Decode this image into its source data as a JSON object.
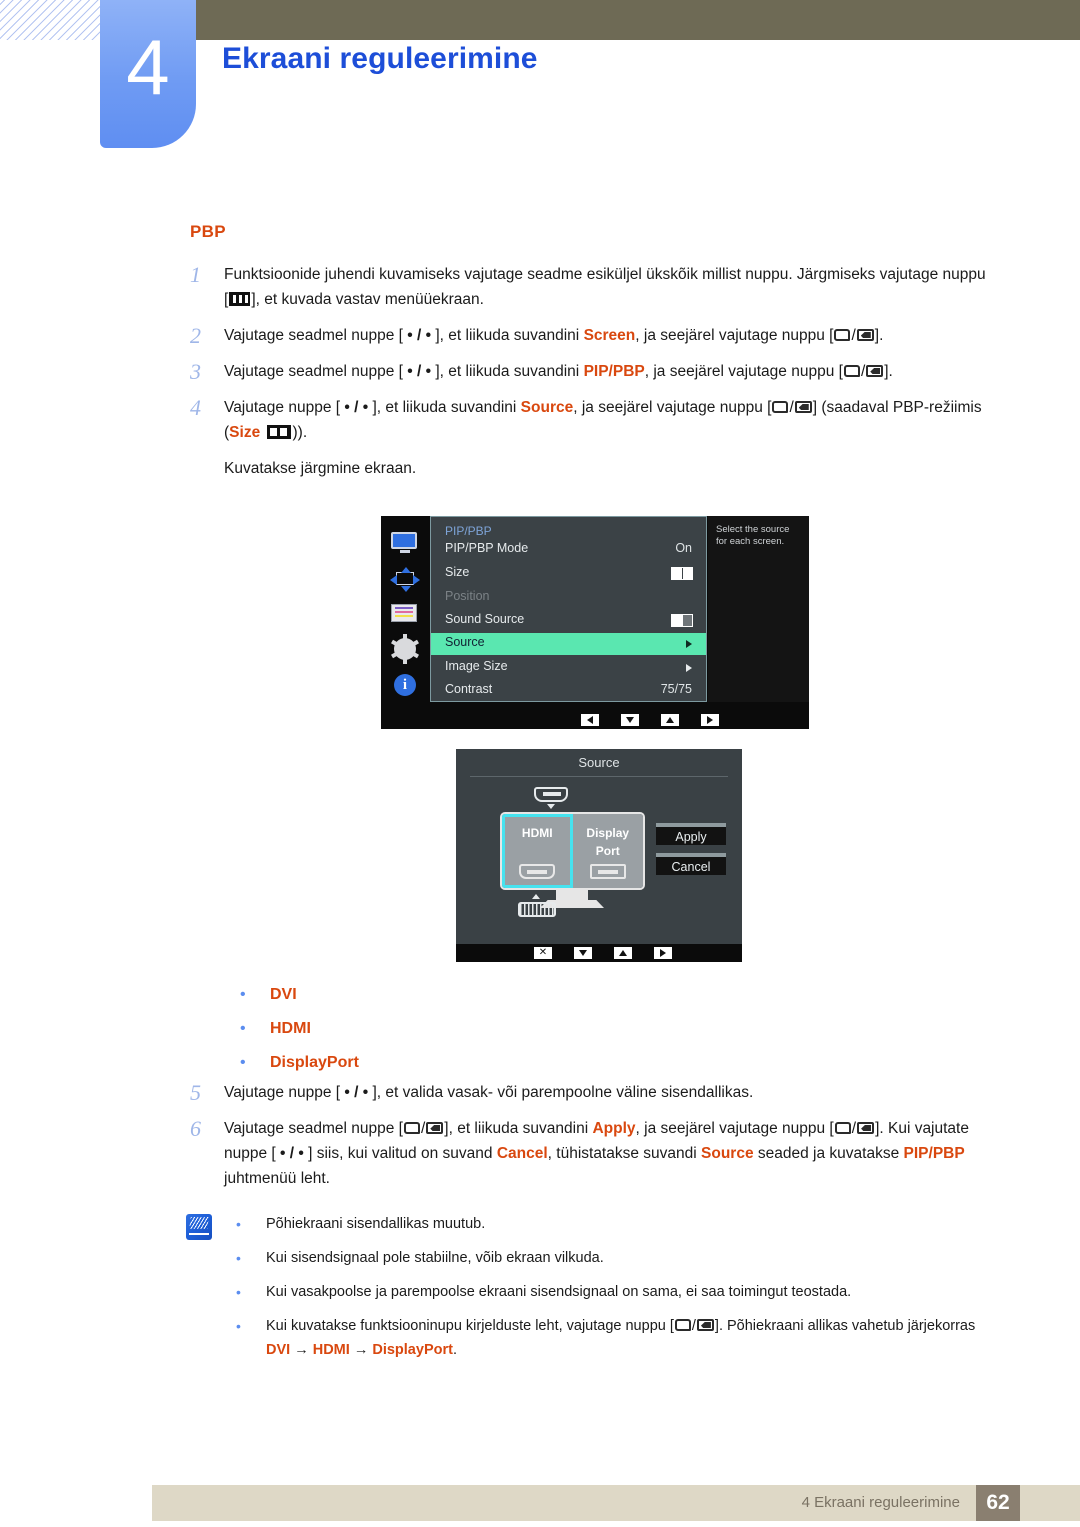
{
  "header": {
    "chapter_number": "4",
    "chapter_title": "Ekraani reguleerimine"
  },
  "section": {
    "heading": "PBP"
  },
  "steps": [
    {
      "num": "1",
      "parts": [
        {
          "t": "Funktsioonide juhendi kuvamiseks vajutage seadme esiküljel ükskõik millist nuppu. Järgmiseks vajutage nuppu [",
          "k": "plain"
        },
        {
          "t": "menu-icon",
          "k": "glyph-menu"
        },
        {
          "t": "], et kuvada vastav menüüekraan.",
          "k": "plain"
        }
      ]
    },
    {
      "num": "2",
      "parts": [
        {
          "t": "Vajutage seadmel nuppe [ ",
          "k": "plain"
        },
        {
          "t": "• / •",
          "k": "dot"
        },
        {
          "t": " ], et liikuda suvandini ",
          "k": "plain"
        },
        {
          "t": "Screen",
          "k": "orange"
        },
        {
          "t": ", ja seejärel vajutage nuppu [",
          "k": "plain"
        },
        {
          "t": "enter-icon",
          "k": "glyph-enter"
        },
        {
          "t": "].",
          "k": "plain"
        }
      ]
    },
    {
      "num": "3",
      "parts": [
        {
          "t": "Vajutage seadmel nuppe [ ",
          "k": "plain"
        },
        {
          "t": "• / •",
          "k": "dot"
        },
        {
          "t": " ], et liikuda suvandini ",
          "k": "plain"
        },
        {
          "t": "PIP/PBP",
          "k": "orange"
        },
        {
          "t": ", ja seejärel vajutage nuppu [",
          "k": "plain"
        },
        {
          "t": "enter-icon",
          "k": "glyph-enter"
        },
        {
          "t": "].",
          "k": "plain"
        }
      ]
    },
    {
      "num": "4",
      "parts": [
        {
          "t": "Vajutage nuppe [ ",
          "k": "plain"
        },
        {
          "t": "• / •",
          "k": "dot"
        },
        {
          "t": " ], et liikuda suvandini ",
          "k": "plain"
        },
        {
          "t": "Source",
          "k": "orange"
        },
        {
          "t": ", ja seejärel vajutage nuppu [",
          "k": "plain"
        },
        {
          "t": "enter-icon",
          "k": "glyph-enter"
        },
        {
          "t": "] (saadaval PBP-režiimis (",
          "k": "plain"
        },
        {
          "t": "Size",
          "k": "orange"
        },
        {
          "t": " ",
          "k": "plain"
        },
        {
          "t": "size-icon",
          "k": "glyph-size"
        },
        {
          "t": ")).",
          "k": "plain"
        }
      ]
    }
  ],
  "after_step4_line": "Kuvatakse järgmine ekraan.",
  "osd_pipbp": {
    "title": "PIP/PBP",
    "tooltip": "Select the source for each screen.",
    "rows": [
      {
        "label": "PIP/PBP Mode",
        "value": "On",
        "kind": "text"
      },
      {
        "label": "Size",
        "value": "",
        "kind": "size"
      },
      {
        "label": "Position",
        "value": "",
        "kind": "dim"
      },
      {
        "label": "Sound Source",
        "value": "",
        "kind": "sound"
      },
      {
        "label": "Source",
        "value": "",
        "kind": "selected"
      },
      {
        "label": "Image Size",
        "value": "",
        "kind": "arrow"
      },
      {
        "label": "Contrast",
        "value": "75/75",
        "kind": "text"
      }
    ],
    "sidebar_icons": [
      "monitor-icon",
      "pip-position-icon",
      "color-bars-icon",
      "gear-icon",
      "info-icon"
    ],
    "control_keys": [
      "left-arrow-key",
      "down-arrow-key",
      "up-arrow-key",
      "right-arrow-key"
    ]
  },
  "osd_source": {
    "title": "Source",
    "left_screen": {
      "line1": "HDMI",
      "line2": ""
    },
    "right_screen": {
      "line1": "Display",
      "line2": "Port"
    },
    "apply_label": "Apply",
    "cancel_label": "Cancel",
    "control_keys": [
      "close-key",
      "down-arrow-key",
      "up-arrow-key",
      "right-arrow-key"
    ]
  },
  "source_list": [
    "DVI",
    "HDMI",
    "DisplayPort"
  ],
  "steps2": [
    {
      "num": "5",
      "parts": [
        {
          "t": "Vajutage nuppe [ ",
          "k": "plain"
        },
        {
          "t": "• / •",
          "k": "dot"
        },
        {
          "t": " ], et valida vasak- või parempoolne väline sisendallikas.",
          "k": "plain"
        }
      ]
    },
    {
      "num": "6",
      "parts": [
        {
          "t": "Vajutage seadmel nuppe [",
          "k": "plain"
        },
        {
          "t": "enter-icon",
          "k": "glyph-enter"
        },
        {
          "t": "], et liikuda suvandini ",
          "k": "plain"
        },
        {
          "t": "Apply",
          "k": "orange"
        },
        {
          "t": ", ja seejärel vajutage nuppu [",
          "k": "plain"
        },
        {
          "t": "enter-icon",
          "k": "glyph-enter"
        },
        {
          "t": "]. Kui vajutate nuppe [ ",
          "k": "plain"
        },
        {
          "t": "• / •",
          "k": "dot"
        },
        {
          "t": " ] siis, kui valitud on suvand ",
          "k": "plain"
        },
        {
          "t": "Cancel",
          "k": "orange"
        },
        {
          "t": ", tühistatakse suvandi ",
          "k": "plain"
        },
        {
          "t": "Source",
          "k": "orange"
        },
        {
          "t": " seaded ja kuvatakse ",
          "k": "plain"
        },
        {
          "t": "PIP/PBP",
          "k": "orange"
        },
        {
          "t": " juhtmenüü leht.",
          "k": "plain"
        }
      ]
    }
  ],
  "note": {
    "icon": "note-pencil-icon",
    "items": [
      [
        {
          "t": "Põhiekraani sisendallikas muutub.",
          "k": "plain"
        }
      ],
      [
        {
          "t": "Kui sisendsignaal pole stabiilne, võib ekraan vilkuda.",
          "k": "plain"
        }
      ],
      [
        {
          "t": "Kui vasakpoolse ja parempoolse ekraani sisendsignaal on sama, ei saa toimingut teostada.",
          "k": "plain"
        }
      ],
      [
        {
          "t": "Kui kuvatakse funktsiooninupu kirjelduste leht, vajutage nuppu [",
          "k": "plain"
        },
        {
          "t": "enter-icon",
          "k": "glyph-enter"
        },
        {
          "t": "]. Põhiekraani allikas vahetub järjekorras ",
          "k": "plain"
        },
        {
          "t": "DVI",
          "k": "orange"
        },
        {
          "t": "  →  ",
          "k": "plain"
        },
        {
          "t": "HDMI",
          "k": "orange"
        },
        {
          "t": "  →  ",
          "k": "plain"
        },
        {
          "t": "DisplayPort",
          "k": "orange"
        },
        {
          "t": ".",
          "k": "plain"
        }
      ]
    ]
  },
  "footer": {
    "text": "4 Ekraani reguleerimine",
    "page": "62"
  },
  "colors": {
    "accent_orange": "#d9480f",
    "chapter_blue": "#1d4ed8",
    "tab_blue": "#6f9bf3",
    "olive": "#6e6a55",
    "footer_band": "#ded8c6",
    "footer_page": "#8a7f70",
    "osd_highlight": "#5ae7b0",
    "osd_panel": "#3b4246",
    "cyan_select": "#46e3ef"
  }
}
